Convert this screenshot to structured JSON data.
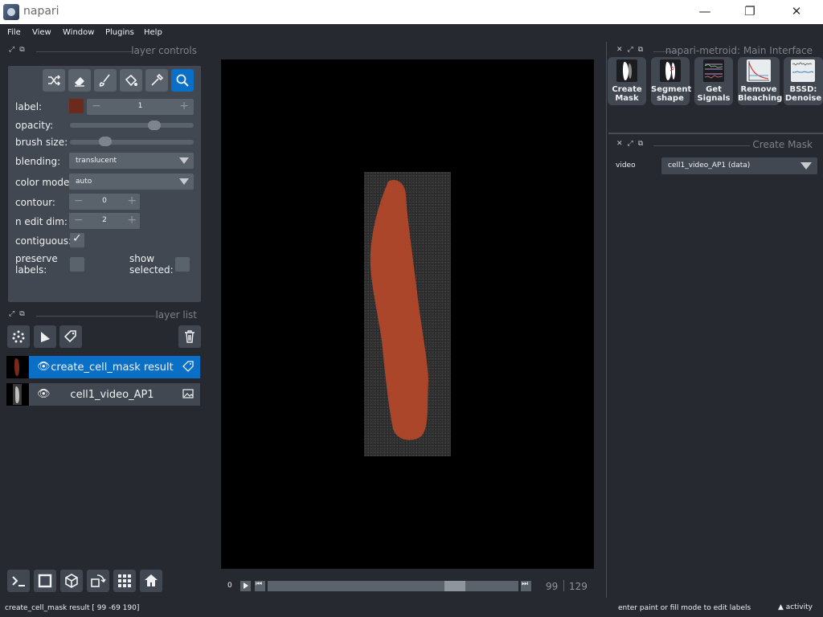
{
  "window": {
    "title": "napari",
    "minimize": "—",
    "restore": "❐",
    "close": "✕"
  },
  "menu": [
    "File",
    "View",
    "Window",
    "Plugins",
    "Help"
  ],
  "layer_controls": {
    "dock_title": "layer controls",
    "tools": [
      "shuffle-icon",
      "eraser-icon",
      "paintbrush-icon",
      "fill-bucket-icon",
      "color-picker-icon",
      "zoom-icon"
    ],
    "label_label": "label:",
    "label_color": "#6b2a1c",
    "label_value": "1",
    "opacity_label": "opacity:",
    "opacity_value": 0.7,
    "brush_size_label": "brush size:",
    "brush_size_fraction": 0.26,
    "blending_label": "blending:",
    "blending_value": "translucent",
    "color_mode_label": "color mode:",
    "color_mode_value": "auto",
    "contour_label": "contour:",
    "contour_value": "0",
    "n_edit_dim_label": "n edit dim:",
    "n_edit_dim_value": "2",
    "contiguous_label": "contiguous:",
    "contiguous_checked": true,
    "preserve_labels_label": "preserve labels:",
    "preserve_labels_checked": false,
    "show_selected_label": "show selected:",
    "show_selected_checked": false
  },
  "layer_list": {
    "dock_title": "layer list",
    "buttons": [
      "new-points-icon",
      "new-shapes-icon",
      "new-labels-icon",
      "delete-layer-icon"
    ],
    "layers": [
      {
        "name": "create_cell_mask result",
        "type_icon": "labels-tag-icon",
        "visible": true,
        "selected": true
      },
      {
        "name": "cell1_video_AP1",
        "type_icon": "image-icon",
        "visible": true,
        "selected": false
      }
    ]
  },
  "console_buttons": [
    "console-icon",
    "toggle-ndisplay-icon",
    "roll-dims-icon",
    "transpose-icon",
    "grid-icon",
    "home-icon"
  ],
  "dims": {
    "current": "0",
    "position": "99",
    "max": "129",
    "slider_fraction": 0.77
  },
  "plugin_dock": {
    "title": "napari-metroid: Main Interface",
    "buttons": [
      {
        "label": "Create Mask"
      },
      {
        "label": "Segment shape"
      },
      {
        "label": "Get Signals"
      },
      {
        "label": "Remove Bleaching"
      },
      {
        "label": "BSSD: Denoise"
      }
    ]
  },
  "create_mask": {
    "dock_title": "Create Mask",
    "video_label": "video",
    "video_value": "cell1_video_AP1 (data)"
  },
  "status": {
    "left": "create_cell_mask result [ 99 -69 190]",
    "help": "enter paint or fill mode to edit labels",
    "activity": "activity"
  },
  "colors": {
    "accent": "#0a6fc7",
    "background": "#262930",
    "panel": "#414851",
    "mask": "#b5482a"
  }
}
